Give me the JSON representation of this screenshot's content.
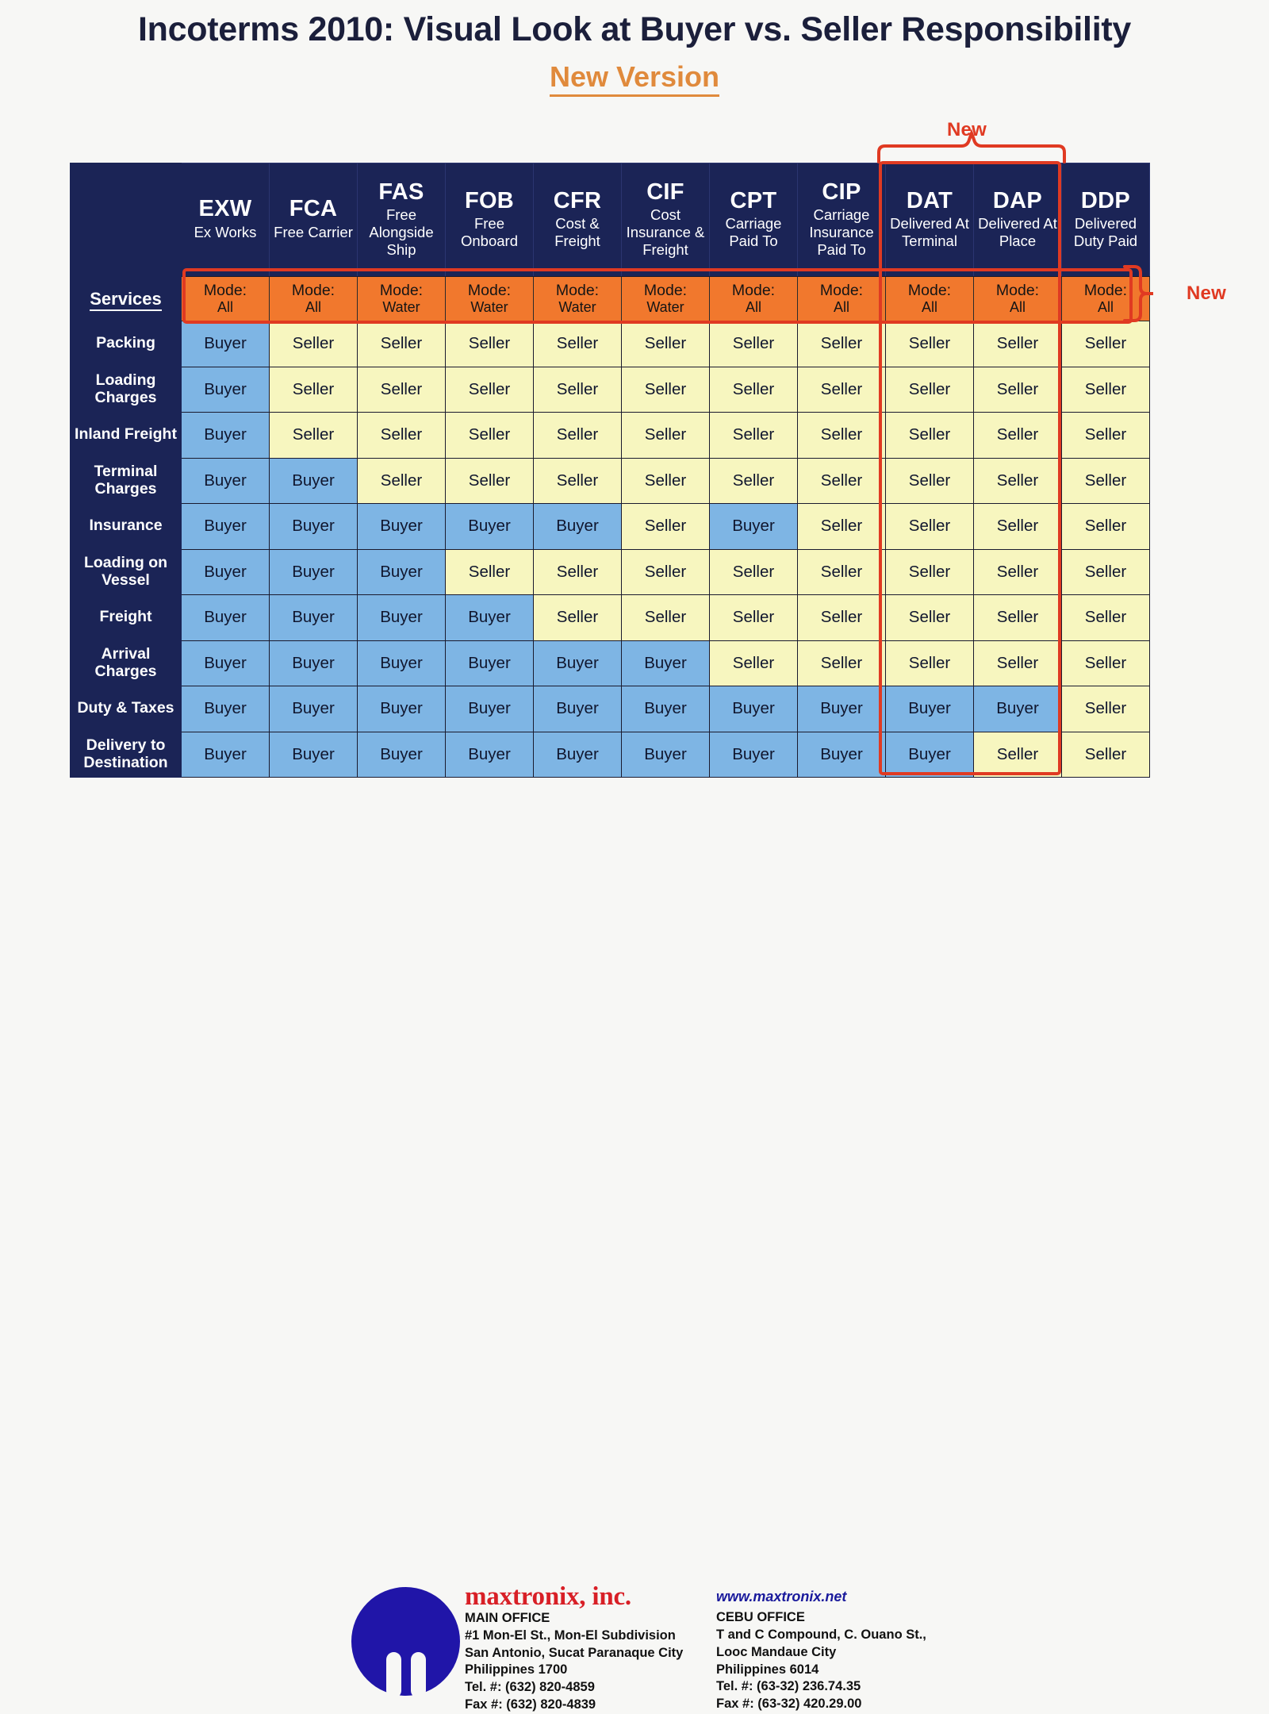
{
  "title": {
    "main": "Incoterms 2010: Visual Look at Buyer vs. Seller Responsibility",
    "sub": "New Version"
  },
  "annotations": {
    "new_columns": "New",
    "new_mode_row": "New"
  },
  "colors": {
    "header_navy": "#1b2456",
    "mode_orange": "#f1782d",
    "buyer_blue": "#7eb5e4",
    "seller_yellow": "#f7f6bf",
    "callout_red": "#e03a22",
    "subtitle_orange": "#e08a3c",
    "company_red": "#d81f26",
    "logo_blue": "#2015a8"
  },
  "table": {
    "services_header": "Services",
    "terms": [
      {
        "code": "EXW",
        "name": "Ex Works",
        "mode_label": "Mode:",
        "mode_value": "All"
      },
      {
        "code": "FCA",
        "name": "Free Carrier",
        "mode_label": "Mode:",
        "mode_value": "All"
      },
      {
        "code": "FAS",
        "name": "Free Alongside Ship",
        "mode_label": "Mode:",
        "mode_value": "Water"
      },
      {
        "code": "FOB",
        "name": "Free Onboard",
        "mode_label": "Mode:",
        "mode_value": "Water"
      },
      {
        "code": "CFR",
        "name": "Cost & Freight",
        "mode_label": "Mode:",
        "mode_value": "Water"
      },
      {
        "code": "CIF",
        "name": "Cost Insurance & Freight",
        "mode_label": "Mode:",
        "mode_value": "Water"
      },
      {
        "code": "CPT",
        "name": "Carriage Paid To",
        "mode_label": "Mode:",
        "mode_value": "All"
      },
      {
        "code": "CIP",
        "name": "Carriage Insurance Paid To",
        "mode_label": "Mode:",
        "mode_value": "All"
      },
      {
        "code": "DAT",
        "name": "Delivered At Terminal",
        "mode_label": "Mode:",
        "mode_value": "All"
      },
      {
        "code": "DAP",
        "name": "Delivered At Place",
        "mode_label": "Mode:",
        "mode_value": "All"
      },
      {
        "code": "DDP",
        "name": "Delivered Duty Paid",
        "mode_label": "Mode:",
        "mode_value": "All"
      }
    ],
    "rows": [
      {
        "service": "Packing",
        "values": [
          "Buyer",
          "Seller",
          "Seller",
          "Seller",
          "Seller",
          "Seller",
          "Seller",
          "Seller",
          "Seller",
          "Seller",
          "Seller"
        ]
      },
      {
        "service": "Loading Charges",
        "values": [
          "Buyer",
          "Seller",
          "Seller",
          "Seller",
          "Seller",
          "Seller",
          "Seller",
          "Seller",
          "Seller",
          "Seller",
          "Seller"
        ]
      },
      {
        "service": "Inland Freight",
        "values": [
          "Buyer",
          "Seller",
          "Seller",
          "Seller",
          "Seller",
          "Seller",
          "Seller",
          "Seller",
          "Seller",
          "Seller",
          "Seller"
        ]
      },
      {
        "service": "Terminal Charges",
        "values": [
          "Buyer",
          "Buyer",
          "Seller",
          "Seller",
          "Seller",
          "Seller",
          "Seller",
          "Seller",
          "Seller",
          "Seller",
          "Seller"
        ]
      },
      {
        "service": "Insurance",
        "values": [
          "Buyer",
          "Buyer",
          "Buyer",
          "Buyer",
          "Buyer",
          "Seller",
          "Buyer",
          "Seller",
          "Seller",
          "Seller",
          "Seller"
        ]
      },
      {
        "service": "Loading on Vessel",
        "values": [
          "Buyer",
          "Buyer",
          "Buyer",
          "Seller",
          "Seller",
          "Seller",
          "Seller",
          "Seller",
          "Seller",
          "Seller",
          "Seller"
        ]
      },
      {
        "service": "Freight",
        "values": [
          "Buyer",
          "Buyer",
          "Buyer",
          "Buyer",
          "Seller",
          "Seller",
          "Seller",
          "Seller",
          "Seller",
          "Seller",
          "Seller"
        ]
      },
      {
        "service": "Arrival Charges",
        "values": [
          "Buyer",
          "Buyer",
          "Buyer",
          "Buyer",
          "Buyer",
          "Buyer",
          "Seller",
          "Seller",
          "Seller",
          "Seller",
          "Seller"
        ]
      },
      {
        "service": "Duty & Taxes",
        "values": [
          "Buyer",
          "Buyer",
          "Buyer",
          "Buyer",
          "Buyer",
          "Buyer",
          "Buyer",
          "Buyer",
          "Buyer",
          "Buyer",
          "Seller"
        ]
      },
      {
        "service": "Delivery to Destination",
        "values": [
          "Buyer",
          "Buyer",
          "Buyer",
          "Buyer",
          "Buyer",
          "Buyer",
          "Buyer",
          "Buyer",
          "Buyer",
          "Seller",
          "Seller"
        ]
      }
    ]
  },
  "footer": {
    "company_name": "maxtronix, inc.",
    "website": "www.maxtronix.net",
    "main_office": {
      "heading": "MAIN OFFICE",
      "lines": [
        "#1 Mon-El St., Mon-El Subdivision",
        "San Antonio, Sucat Paranaque City",
        "Philippines 1700",
        "Tel. #: (632) 820-4859",
        "Fax #: (632) 820-4839"
      ]
    },
    "cebu_office": {
      "heading": "CEBU OFFICE",
      "lines": [
        "T and C Compound, C. Ouano St.,",
        "Looc Mandaue City",
        "Philippines 6014",
        "Tel. #: (63-32) 236.74.35",
        "Fax #: (63-32) 420.29.00"
      ]
    }
  }
}
